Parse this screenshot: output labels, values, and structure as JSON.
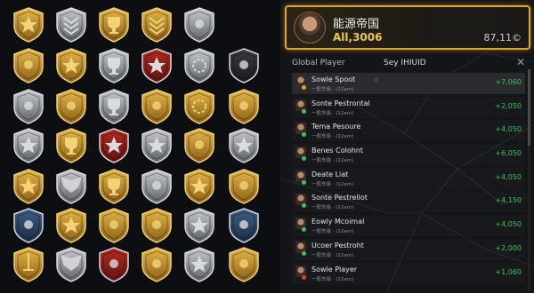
{
  "profile": {
    "name": "能源帝国",
    "score": "All,3006",
    "total": "87,11©"
  },
  "leaderboard": {
    "col_left": "Global Player",
    "col_mid": "Sey IHIUID",
    "close": "✕",
    "rows": [
      {
        "name": "Sowle Spoot",
        "sub": "一般东级 · (12am)",
        "score": "+7,060",
        "dot": "#e0a62a",
        "mark": "◇"
      },
      {
        "name": "Sonte Pestrontal",
        "sub": "一般东级 · (12am)",
        "score": "+2,050",
        "dot": "#3ec25a"
      },
      {
        "name": "Tema Pesoure",
        "sub": "一般东级 · (12am)",
        "score": "+4,050",
        "dot": "#3ec25a"
      },
      {
        "name": "Benes Colohnt",
        "sub": "一般东级 · (12am)",
        "score": "+6,050",
        "dot": "#3ec25a"
      },
      {
        "name": "Deate Liat",
        "sub": "一般东级 · (12am)",
        "score": "+4,050",
        "dot": "#3ec25a"
      },
      {
        "name": "Sonte Pestrellot",
        "sub": "一般东级 · (12am)",
        "score": "+4,150",
        "dot": "#3ec25a"
      },
      {
        "name": "Eowly Mcoimal",
        "sub": "一般东级 · (12am)",
        "score": "+4,050",
        "dot": "#3ec25a"
      },
      {
        "name": "Ucoer Pestroht",
        "sub": "一般东级 · (12am)",
        "score": "+2,000",
        "dot": "#3ec25a"
      },
      {
        "name": "Sowle Player",
        "sub": "一般东级 · (12am)",
        "score": "+1,060",
        "dot": "#e03a3a"
      }
    ]
  },
  "badges": [
    [
      "shield-star-gold",
      "chevron-silver",
      "trophy-gold",
      "rank-chevrons-gold",
      "shield-silver"
    ],
    [
      "shield-plain-gold",
      "shield-star-gold",
      "cup-silver",
      "shield-star-red",
      "wreath-silver",
      "shield-dark"
    ],
    [
      "shield-silver",
      "shield-gold",
      "cup-silver",
      "shield-gold",
      "wreath-gold",
      "medal-gold"
    ],
    [
      "shield-star-silver",
      "trophy-gold",
      "shield-star-red",
      "star-silver",
      "shield-gold",
      "star-silver"
    ],
    [
      "shield-star-gold",
      "wings-silver",
      "trophy-gold",
      "shield-silver",
      "shield-star-gold",
      "crest-gold"
    ],
    [
      "shield-blue",
      "shield-star-gold",
      "crest-gold",
      "shield-gold",
      "star-silver",
      "shield-blue"
    ],
    [
      "sword-gold",
      "wings-silver",
      "shield-red",
      "shield-gold",
      "star-silver",
      "shield-gold"
    ]
  ],
  "colors": {
    "gold": "#d9a93a",
    "silver": "#b8bcc2",
    "accent": "#e0a62a",
    "positive": "#3ec25a"
  }
}
